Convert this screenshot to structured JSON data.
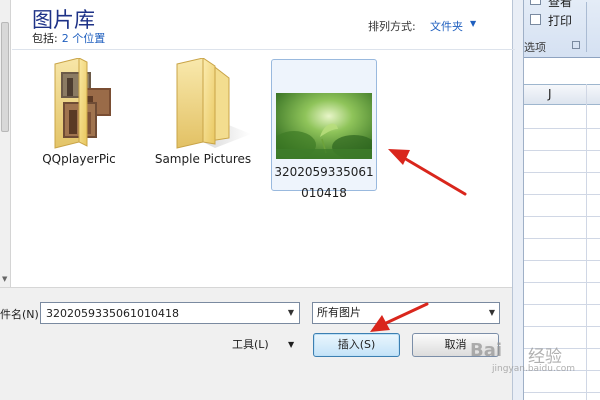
{
  "library": {
    "title": "图片库",
    "includes_label": "包括:",
    "locations_link": "2 个位置",
    "sort_label": "排列方式:",
    "sort_value": "文件夹"
  },
  "files": [
    {
      "name": "QQplayerPic",
      "type": "folder",
      "icon": "folder-with-photos-icon"
    },
    {
      "name": "Sample Pictures",
      "type": "folder",
      "icon": "folder-icon"
    },
    {
      "name_line1": "3202059335061",
      "name_line2": "010418",
      "type": "image",
      "icon": "image-thumbnail",
      "selected": true
    }
  ],
  "bottom": {
    "filename_label": "件名(N):",
    "filename_value": "3202059335061010418",
    "filter_value": "所有图片",
    "tools_label": "工具(L)",
    "insert_label": "插入(S)",
    "cancel_label": "取消"
  },
  "excel": {
    "checkbox1_label": "查看",
    "checkbox2_label": "打印",
    "group_label": "选项",
    "column_header": "J"
  },
  "watermark": {
    "brand": "Bai",
    "brand_suffix": "经验",
    "url": "jingyan.baidu.com"
  },
  "colors": {
    "title_blue": "#1e3287",
    "link_blue": "#1f5fbf",
    "annotation_red": "#d9261c",
    "selection_border": "#99b9de"
  }
}
